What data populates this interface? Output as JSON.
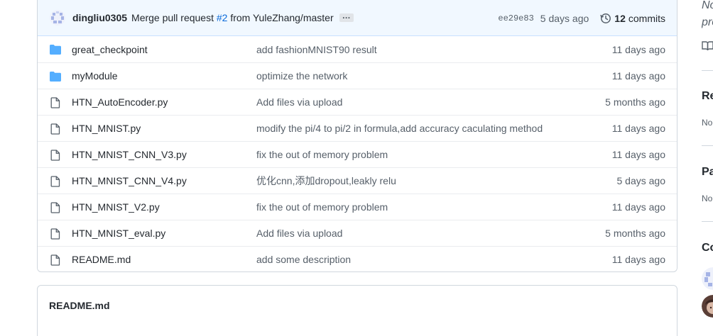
{
  "commit": {
    "author": "dingliu0305",
    "message_prefix": "Merge pull request ",
    "pr_link": "#2",
    "message_suffix": " from YuleZhang/master",
    "ellipsis": "…",
    "sha": "ee29e83",
    "time": "5 days ago",
    "commits_count": "12",
    "commits_label": "commits"
  },
  "files": [
    {
      "name": "great_checkpoint",
      "type": "folder",
      "message": "add fashionMNIST90 result",
      "age": "11 days ago"
    },
    {
      "name": "myModule",
      "type": "folder",
      "message": "optimize the network",
      "age": "11 days ago"
    },
    {
      "name": "HTN_AutoEncoder.py",
      "type": "file",
      "message": "Add files via upload",
      "age": "5 months ago"
    },
    {
      "name": "HTN_MNIST.py",
      "type": "file",
      "message": "modify the pi/4 to pi/2 in formula,add accuracy caculating method",
      "age": "11 days ago"
    },
    {
      "name": "HTN_MNIST_CNN_V3.py",
      "type": "file",
      "message": "fix the out of memory problem",
      "age": "11 days ago"
    },
    {
      "name": "HTN_MNIST_CNN_V4.py",
      "type": "file",
      "message": "优化cnn,添加dropout,leakly relu",
      "age": "5 days ago"
    },
    {
      "name": "HTN_MNIST_V2.py",
      "type": "file",
      "message": "fix the out of memory problem",
      "age": "11 days ago"
    },
    {
      "name": "HTN_MNIST_eval.py",
      "type": "file",
      "message": "Add files via upload",
      "age": "5 months ago"
    },
    {
      "name": "README.md",
      "type": "file",
      "message": "add some description",
      "age": "11 days ago"
    }
  ],
  "readme": {
    "title": "README.md"
  },
  "sidebar": {
    "about_line1": "No",
    "about_line2": "pro",
    "releases_heading": "Re",
    "releases_none": "No",
    "packages_heading": "Pa",
    "packages_none": "No",
    "contributors_heading": "Co"
  },
  "colors": {
    "folder": "#54aeff",
    "link": "#0969da",
    "commit_bar_bg": "#f1f8ff"
  }
}
